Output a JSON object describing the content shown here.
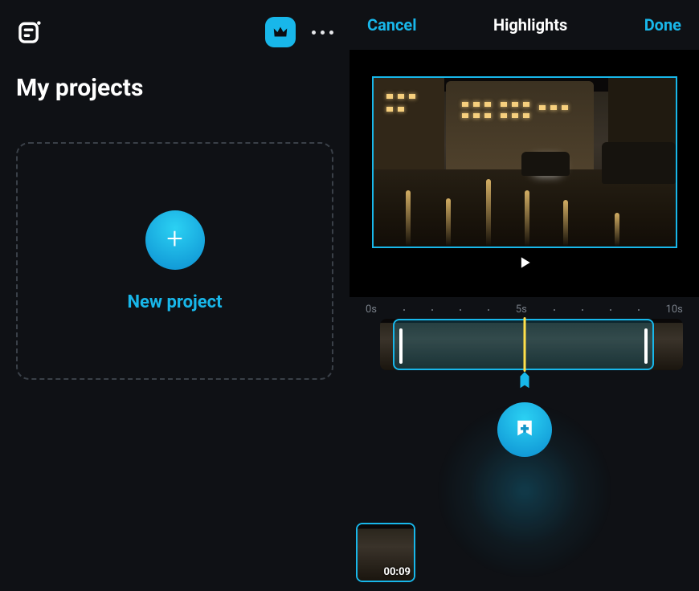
{
  "colors": {
    "accent": "#18b7ea",
    "background": "#0f1115",
    "playhead": "#ffdf4a"
  },
  "left": {
    "page_title": "My projects",
    "new_project_label": "New project"
  },
  "right": {
    "cancel_label": "Cancel",
    "title": "Highlights",
    "done_label": "Done",
    "timeline": {
      "ruler_labels": [
        "0s",
        "5s",
        "10s"
      ]
    },
    "clip_thumb": {
      "duration": "00:09"
    }
  }
}
